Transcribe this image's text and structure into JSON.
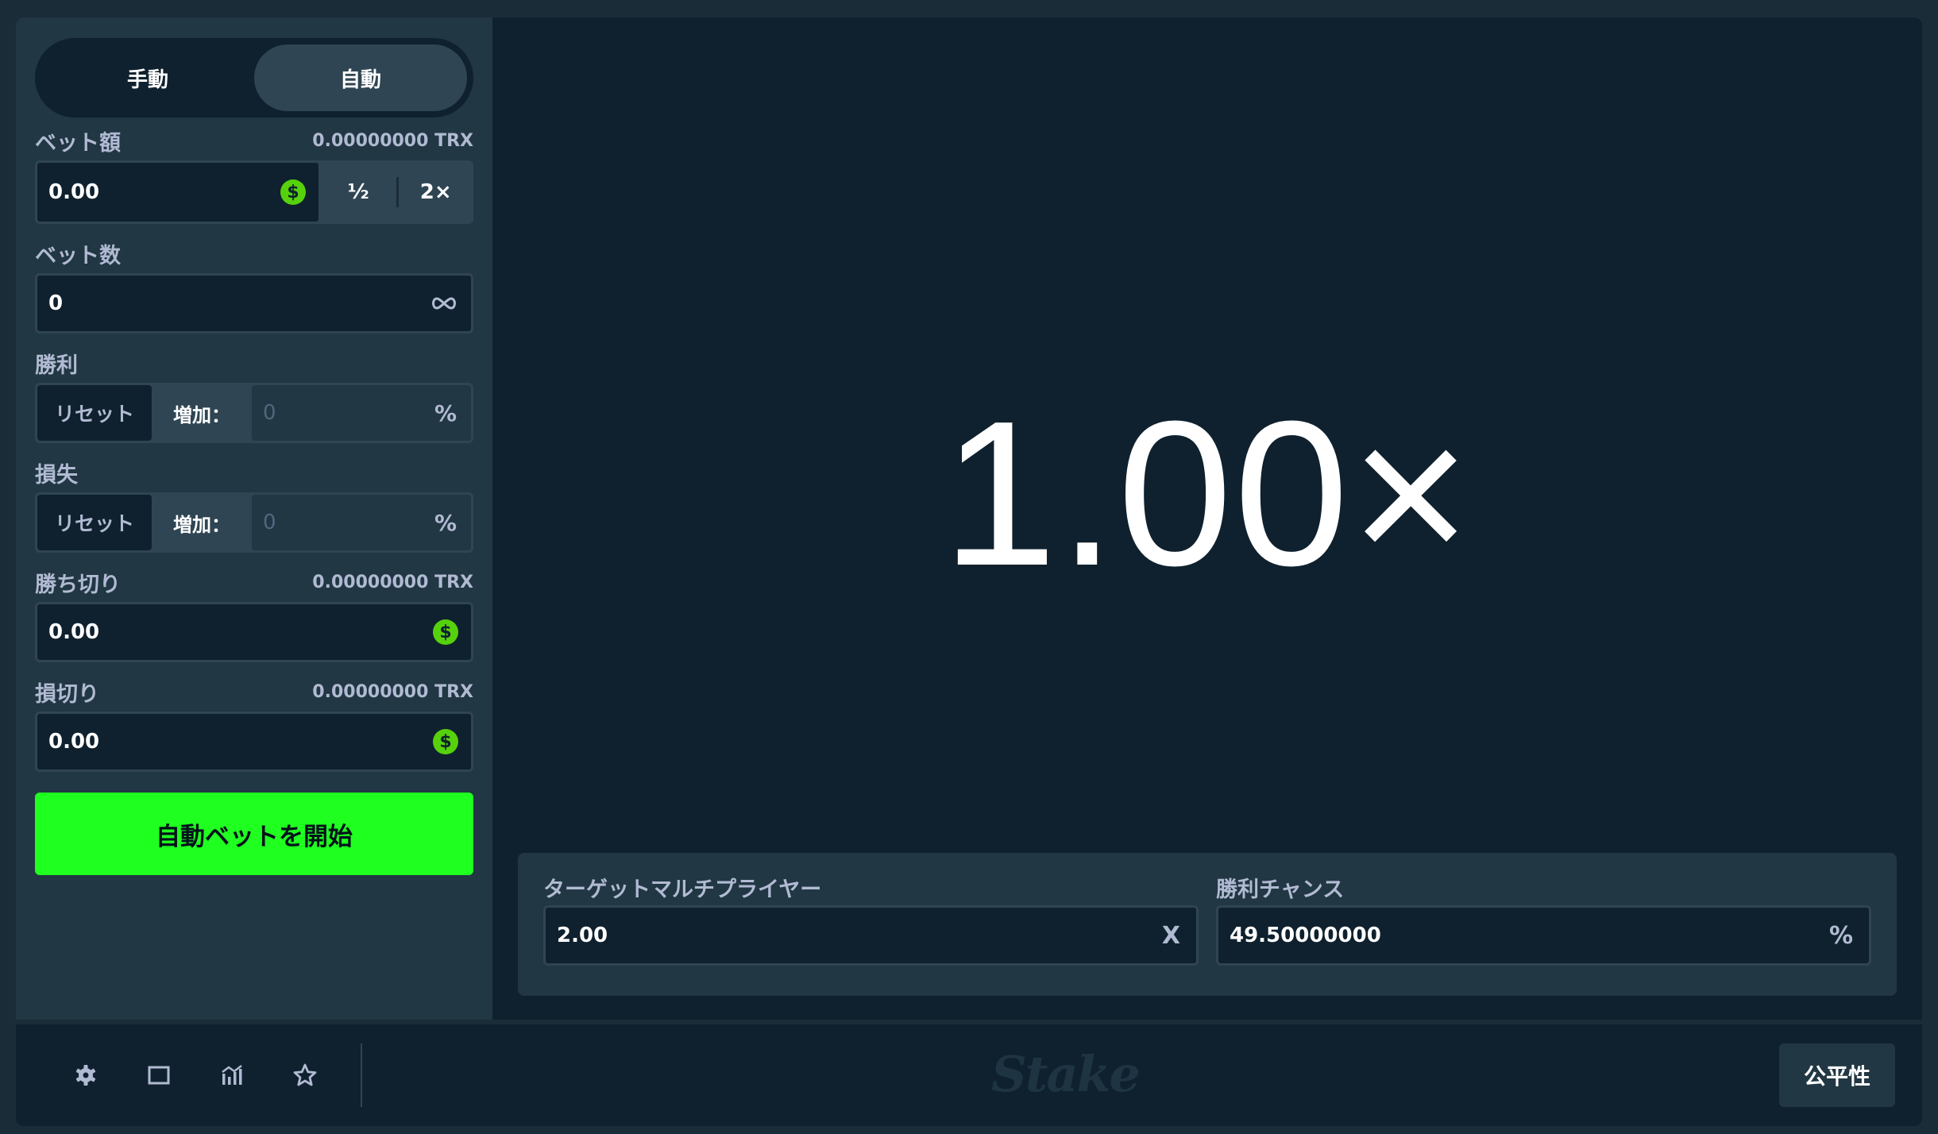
{
  "mode_toggle": {
    "manual_label": "手動",
    "auto_label": "自動",
    "active": "auto"
  },
  "bet_amount": {
    "label": "ベット額",
    "balance": "0.00000000 TRX",
    "value": "0.00",
    "currency_icon": "$",
    "half_label": "½",
    "double_label": "2×"
  },
  "bet_count": {
    "label": "ベット数",
    "value": "0",
    "icon": "infinity-icon"
  },
  "on_win": {
    "label": "勝利",
    "reset_label": "リセット",
    "increase_label": "増加：",
    "value": "0",
    "suffix": "%"
  },
  "on_loss": {
    "label": "損失",
    "reset_label": "リセット",
    "increase_label": "増加：",
    "value": "0",
    "suffix": "%"
  },
  "stop_on_profit": {
    "label": "勝ち切り",
    "balance": "0.00000000 TRX",
    "value": "0.00",
    "currency_icon": "$"
  },
  "stop_on_loss": {
    "label": "損切り",
    "balance": "0.00000000 TRX",
    "value": "0.00",
    "currency_icon": "$"
  },
  "start_button": {
    "label": "自動ベットを開始"
  },
  "game": {
    "multiplier": "1.00×"
  },
  "target": {
    "multiplier_label": "ターゲットマルチプライヤー",
    "multiplier_value": "2.00",
    "multiplier_suffix": "X",
    "chance_label": "勝利チャンス",
    "chance_value": "49.50000000",
    "chance_suffix": "%"
  },
  "footer": {
    "icons": [
      "gear-icon",
      "square-icon",
      "chart-icon",
      "star-icon"
    ],
    "logo": "Stake",
    "fairness_label": "公平性"
  },
  "colors": {
    "page_bg": "#1a2c38",
    "panel_bg": "#213743",
    "input_bg": "#0f212e",
    "border": "#2f4553",
    "label": "#b1bad3",
    "accent_green": "#1fff20",
    "coin_green": "#56d10c"
  }
}
